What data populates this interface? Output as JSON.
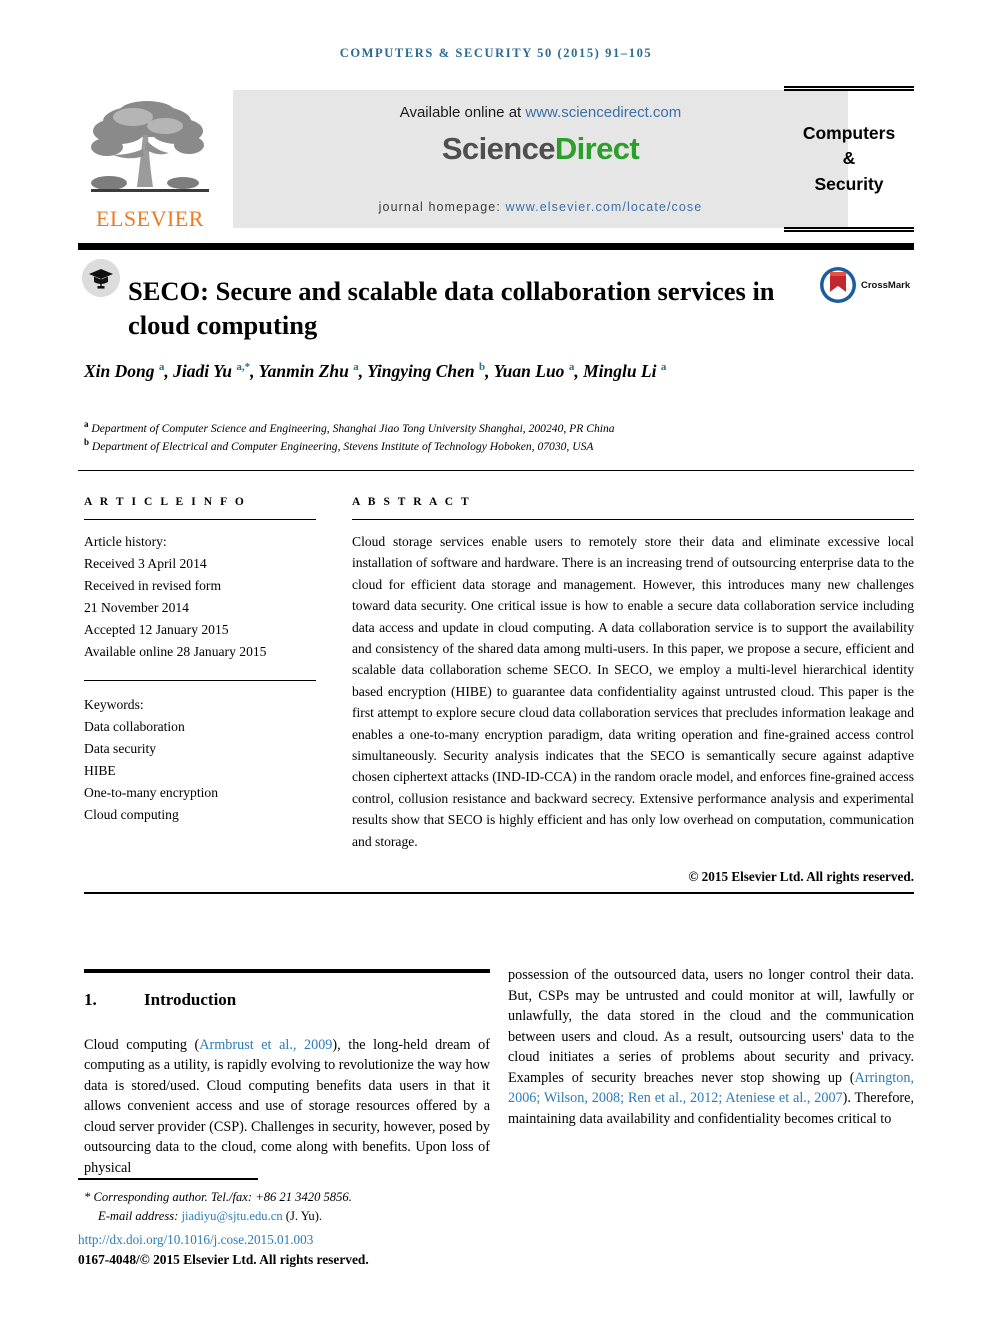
{
  "running_head": "COMPUTERS & SECURITY 50 (2015) 91–105",
  "masthead": {
    "publisher": "ELSEVIER",
    "available_prefix": "Available online at ",
    "available_link": "www.sciencedirect.com",
    "logo_part1": "Science",
    "logo_part2": "Direct",
    "homepage_prefix": "journal homepage: ",
    "homepage_link": "www.elsevier.com/locate/cose",
    "journal_line1": "Computers",
    "journal_line2": "&",
    "journal_line3": "Security",
    "crossmark_label": "CrossMark"
  },
  "article": {
    "title": "SECO: Secure and scalable data collaboration services in cloud computing",
    "authors_html": "Xin Dong <sup>a</sup>, Jiadi Yu <sup class=\"star\">a,*</sup>, Yanmin Zhu <sup>a</sup>, Yingying Chen <sup>b</sup>, Yuan Luo <sup>a</sup>, Minglu Li <sup>a</sup>",
    "affiliation_a_marker": "a",
    "affiliation_a": " Department of Computer Science and Engineering, Shanghai Jiao Tong University Shanghai, 200240, PR China",
    "affiliation_b_marker": "b",
    "affiliation_b": " Department of Electrical and Computer Engineering, Stevens Institute of Technology Hoboken, 07030, USA"
  },
  "article_info": {
    "heading": "A R T I C L E   I N F O",
    "history_label": "Article history:",
    "history": [
      "Received 3 April 2014",
      "Received in revised form",
      "21 November 2014",
      "Accepted 12 January 2015",
      "Available online 28 January 2015"
    ],
    "keywords_label": "Keywords:",
    "keywords": [
      "Data collaboration",
      "Data security",
      "HIBE",
      "One-to-many encryption",
      "Cloud computing"
    ]
  },
  "abstract": {
    "heading": "A B S T R A C T",
    "text": "Cloud storage services enable users to remotely store their data and eliminate excessive local installation of software and hardware. There is an increasing trend of outsourcing enterprise data to the cloud for efficient data storage and management. However, this introduces many new challenges toward data security. One critical issue is how to enable a secure data collaboration service including data access and update in cloud computing. A data collaboration service is to support the availability and consistency of the shared data among multi-users. In this paper, we propose a secure, efficient and scalable data collaboration scheme SECO. In SECO, we employ a multi-level hierarchical identity based encryption (HIBE) to guarantee data confidentiality against untrusted cloud. This paper is the first attempt to explore secure cloud data collaboration services that precludes information leakage and enables a one-to-many encryption paradigm, data writing operation and fine-grained access control simultaneously. Security analysis indicates that the SECO is semantically secure against adaptive chosen ciphertext attacks (IND-ID-CCA) in the random oracle model, and enforces fine-grained access control, collusion resistance and backward secrecy. Extensive performance analysis and experimental results show that SECO is highly efficient and has only low overhead on computation, communication and storage.",
    "copyright": "© 2015 Elsevier Ltd. All rights reserved."
  },
  "introduction": {
    "number": "1.",
    "title": "Introduction",
    "left_part1": "Cloud computing (",
    "left_cite1": "Armbrust et al., 2009",
    "left_part2": "), the long-held dream of computing as a utility, is rapidly evolving to revolutionize the way how data is stored/used. Cloud computing benefits data users in that it allows convenient access and use of storage resources offered by a cloud server provider (CSP). Challenges in security, however, posed by outsourcing data to the cloud, come along with benefits. Upon loss of physical",
    "right_part1": "possession of the outsourced data, users no longer control their data. But, CSPs may be untrusted and could monitor at will, lawfully or unlawfully, the data stored in the cloud and the communication between users and cloud. As a result, outsourcing users' data to the cloud initiates a series of problems about security and privacy. Examples of security breaches never stop showing up (",
    "right_cite1": "Arrington, 2006; Wilson, 2008; Ren et al., 2012; Ateniese et al., 2007",
    "right_part2": "). Therefore, maintaining data availability and confidentiality becomes critical to"
  },
  "footer": {
    "corresponding_marker": "*",
    "corresponding_text": " Corresponding author. Tel./fax: +86 21 3420 5856.",
    "email_label": "E-mail address: ",
    "email_link": "jiadiyu@sjtu.edu.cn",
    "email_suffix": " (J. Yu).",
    "doi": "http://dx.doi.org/10.1016/j.cose.2015.01.003",
    "issn": "0167-4048/© 2015 Elsevier Ltd. All rights reserved."
  },
  "colors": {
    "link_blue": "#2b7bb9",
    "elsevier_orange": "#eb7c22",
    "sciencedirect_green": "#2aa02a",
    "banner_gray": "#e6e6e6"
  }
}
